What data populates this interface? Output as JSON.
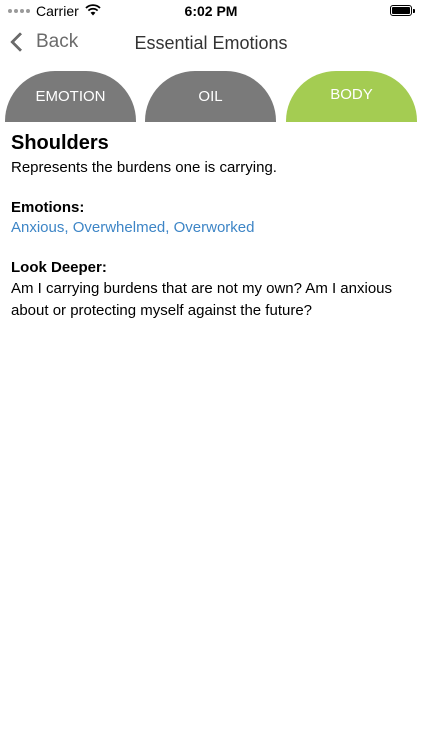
{
  "status_bar": {
    "carrier": "Carrier",
    "time": "6:02 PM"
  },
  "nav": {
    "back_label": "Back",
    "title": "Essential Emotions"
  },
  "tabs": [
    {
      "label": "EMOTION",
      "selected": false
    },
    {
      "label": "OIL",
      "selected": false
    },
    {
      "label": "BODY",
      "selected": true
    }
  ],
  "colors": {
    "tab_inactive": "#7a7a7a",
    "tab_active": "#a4cc52",
    "link": "#3d85c6"
  },
  "content": {
    "title": "Shoulders",
    "description": "Represents the burdens one is carrying.",
    "emotions_heading": "Emotions:",
    "emotions": [
      "Anxious",
      "Overwhelmed",
      "Overworked"
    ],
    "look_deeper_heading": "Look Deeper:",
    "look_deeper_text": "Am I carrying burdens that are not my own? Am I anxious about or protecting myself against the future?"
  }
}
